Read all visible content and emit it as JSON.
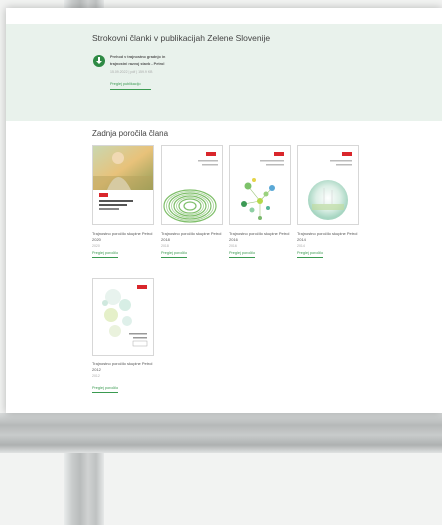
{
  "panel": {
    "title": "Strokovni članki v publikacijah Zelene Slovenije",
    "document": {
      "title_line1": "Prehod v trajnostno gradnjo in",
      "title_line2": "trajnostni razvoj stavb - Petrol",
      "meta": "15.09.2022 | pdf | 159.9 KB"
    },
    "link_label": "Preglej publikacijo"
  },
  "section": {
    "title": "Zadnja poročila člana"
  },
  "reports": [
    {
      "title": "Trajnostno poročilo skupine Petrol 2020",
      "year": "2020",
      "link": "Preglej poročilo"
    },
    {
      "title": "Trajnostno poročilo skupine Petrol 2018",
      "year": "2018",
      "link": "Preglej poročilo"
    },
    {
      "title": "Trajnostno poročilo skupine Petrol 2016",
      "year": "2016",
      "link": "Preglej poročilo"
    },
    {
      "title": "Trajnostno poročilo skupine Petrol 2014",
      "year": "2014",
      "link": "Preglej poročilo"
    },
    {
      "title": "Trajnostno poročilo skupine Petrol 2012",
      "year": "2012",
      "link": "Preglej poročilo"
    }
  ],
  "colors": {
    "accent_green": "#3a9a50",
    "panel_bg": "#e9f2ec",
    "brand_red": "#d9262b"
  }
}
